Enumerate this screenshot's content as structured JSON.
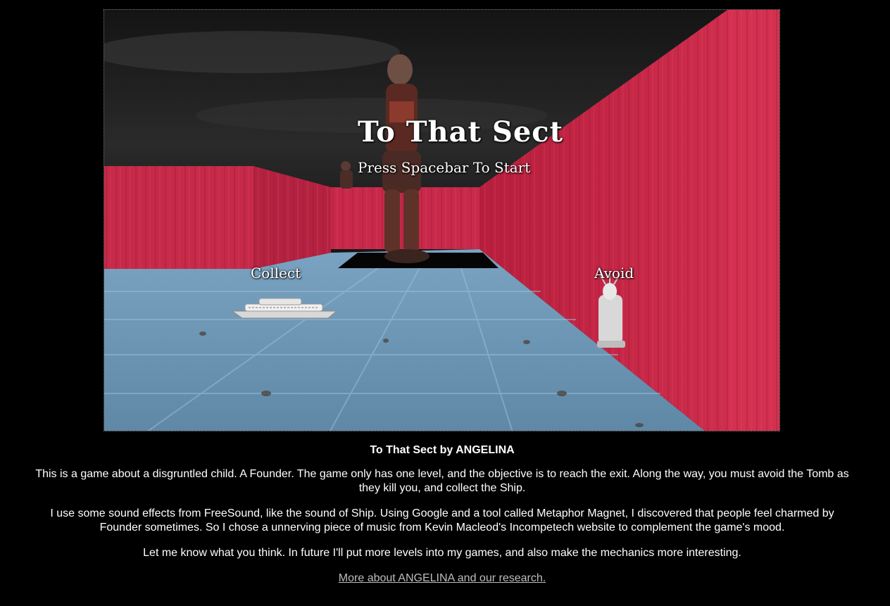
{
  "game": {
    "title": "To That Sect",
    "start_prompt": "Press Spacebar To Start",
    "collect_label": "Collect",
    "avoid_label": "Avoid",
    "colors": {
      "wall": "#c8294a",
      "wall_dark": "#8e1730",
      "floor": "#6f97b3",
      "sky": "#1a1a1a"
    }
  },
  "description": {
    "heading": "To That Sect by ANGELINA",
    "paragraph_1": "This is a game about a disgruntled child. A Founder. The game only has one level, and the objective is to reach the exit. Along the way, you must avoid the Tomb as they kill you, and collect the Ship.",
    "paragraph_2": "I use some sound effects from FreeSound, like the sound of Ship. Using Google and a tool called Metaphor Magnet, I discovered that people feel charmed by Founder sometimes. So I chose a unnerving piece of music from Kevin Macleod's Incompetech website to complement the game's mood.",
    "paragraph_3": "Let me know what you think. In future I'll put more levels into my games, and also make the mechanics more interesting.",
    "link_text": "More about ANGELINA and our research."
  }
}
